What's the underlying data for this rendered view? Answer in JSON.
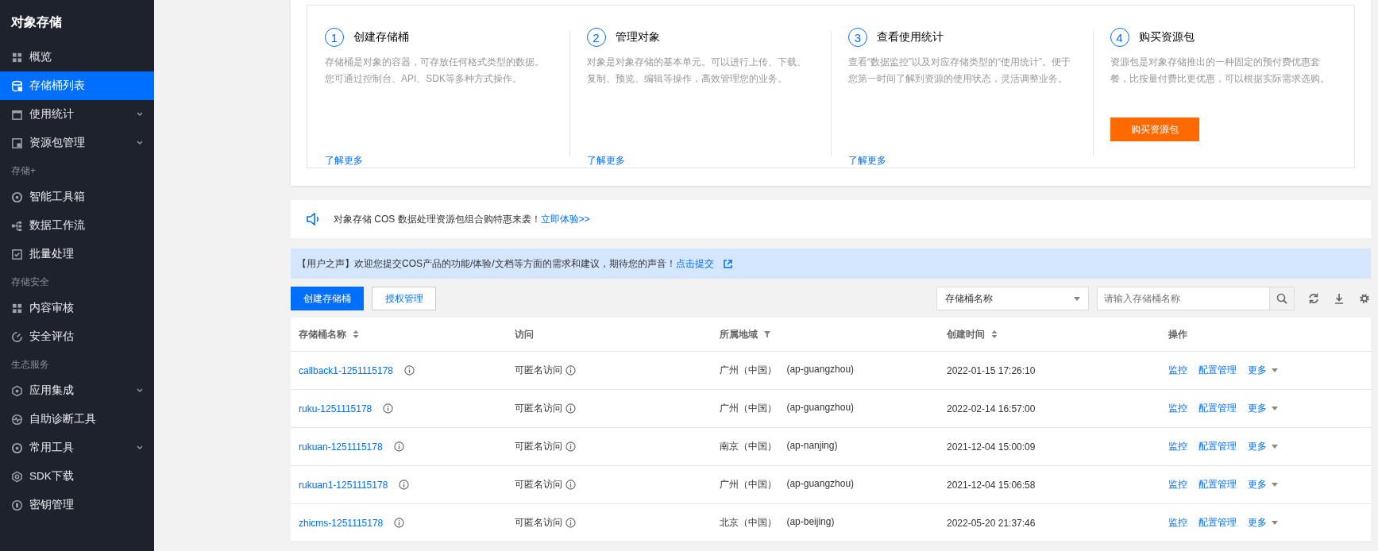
{
  "sidebar": {
    "title": "对象存储",
    "groups": [
      {
        "items": [
          {
            "label": "概览",
            "selected": false
          },
          {
            "label": "存储桶列表",
            "selected": true
          },
          {
            "label": "使用统计",
            "selected": false,
            "expanded": false
          },
          {
            "label": "资源包管理",
            "selected": false,
            "expanded": false
          }
        ]
      },
      {
        "heading": "存储+",
        "items": [
          {
            "label": "智能工具箱",
            "selected": false
          },
          {
            "label": "数据工作流",
            "selected": false
          },
          {
            "label": "批量处理",
            "selected": false
          }
        ]
      },
      {
        "heading": "存储安全",
        "items": [
          {
            "label": "内容审核",
            "selected": false
          },
          {
            "label": "安全评估",
            "selected": false
          }
        ]
      },
      {
        "heading": "生态服务",
        "items": [
          {
            "label": "应用集成",
            "selected": false,
            "expanded": false
          },
          {
            "label": "自助诊断工具",
            "selected": false
          },
          {
            "label": "常用工具",
            "selected": false,
            "expanded": false
          },
          {
            "label": "SDK下载",
            "selected": false
          },
          {
            "label": "密钥管理",
            "selected": false
          }
        ]
      }
    ]
  },
  "steps": [
    {
      "number": "1",
      "title": "创建存储桶",
      "description": "存储桶是对象的容器，可存放任何格式类型的数据。您可通过控制台、API、SDK等多种方式操作。",
      "action": {
        "kind": "link",
        "label": "了解更多"
      }
    },
    {
      "number": "2",
      "title": "管理对象",
      "description": "对象是对象存储的基本单元。可以进行上传、下载、复制、预览、编辑等操作，高效管理您的业务。",
      "action": {
        "kind": "link",
        "label": "了解更多"
      }
    },
    {
      "number": "3",
      "title": "查看使用统计",
      "description": "查看“数据监控”以及对应存储类型的“使用统计”。便于您第一时间了解到资源的使用状态，灵活调整业务。",
      "action": {
        "kind": "link",
        "label": "了解更多"
      }
    },
    {
      "number": "4",
      "title": "购买资源包",
      "description": "资源包是对象存储推出的一种固定的预付费优惠套餐，比按量付费比更优惠，可以根据实际需求选购。",
      "action": {
        "kind": "button",
        "label": "购买资源包"
      }
    }
  ],
  "notice": {
    "text": "对象存储 COS 数据处理资源包组合购特惠来袭！",
    "link": "立即体验>>"
  },
  "feedback": {
    "text": "【用户之声】欢迎您提交COS产品的功能/体验/文档等方面的需求和建议，期待您的声音！",
    "link": "点击提交"
  },
  "toolbar": {
    "primary_button": "创建存储桶",
    "secondary_button": "授权管理",
    "filter_select": "存储桶名称",
    "search": {
      "placeholder": "请输入存储桶名称"
    }
  },
  "table": {
    "columns": [
      {
        "label": "存储桶名称",
        "kind": "sortable"
      },
      {
        "label": "访问",
        "kind": "plain"
      },
      {
        "label": "所属地域",
        "kind": "filter"
      },
      {
        "label": "创建时间",
        "kind": "sortable"
      },
      {
        "label": "操作",
        "kind": "plain"
      }
    ],
    "rows": [
      {
        "name": "callback1-1251115178",
        "access": "可匿名访问",
        "region": "广州（中国）",
        "region_code": "(ap-guangzhou)",
        "created": "2022-01-15 17:26:10",
        "actions": [
          "监控",
          "配置管理",
          "更多"
        ]
      },
      {
        "name": "ruku-1251115178",
        "access": "可匿名访问",
        "region": "广州（中国）",
        "region_code": "(ap-guangzhou)",
        "created": "2022-02-14 16:57:00",
        "actions": [
          "监控",
          "配置管理",
          "更多"
        ]
      },
      {
        "name": "rukuan-1251115178",
        "access": "可匿名访问",
        "region": "南京（中国）",
        "region_code": "(ap-nanjing)",
        "created": "2021-12-04 15:00:09",
        "actions": [
          "监控",
          "配置管理",
          "更多"
        ]
      },
      {
        "name": "rukuan1-1251115178",
        "access": "可匿名访问",
        "region": "广州（中国）",
        "region_code": "(ap-guangzhou)",
        "created": "2021-12-04 15:06:58",
        "actions": [
          "监控",
          "配置管理",
          "更多"
        ]
      },
      {
        "name": "zhicms-1251115178",
        "access": "可匿名访问",
        "region": "北京（中国）",
        "region_code": "(ap-beijing)",
        "created": "2022-05-20 21:37:46",
        "actions": [
          "监控",
          "配置管理",
          "更多"
        ]
      }
    ]
  }
}
